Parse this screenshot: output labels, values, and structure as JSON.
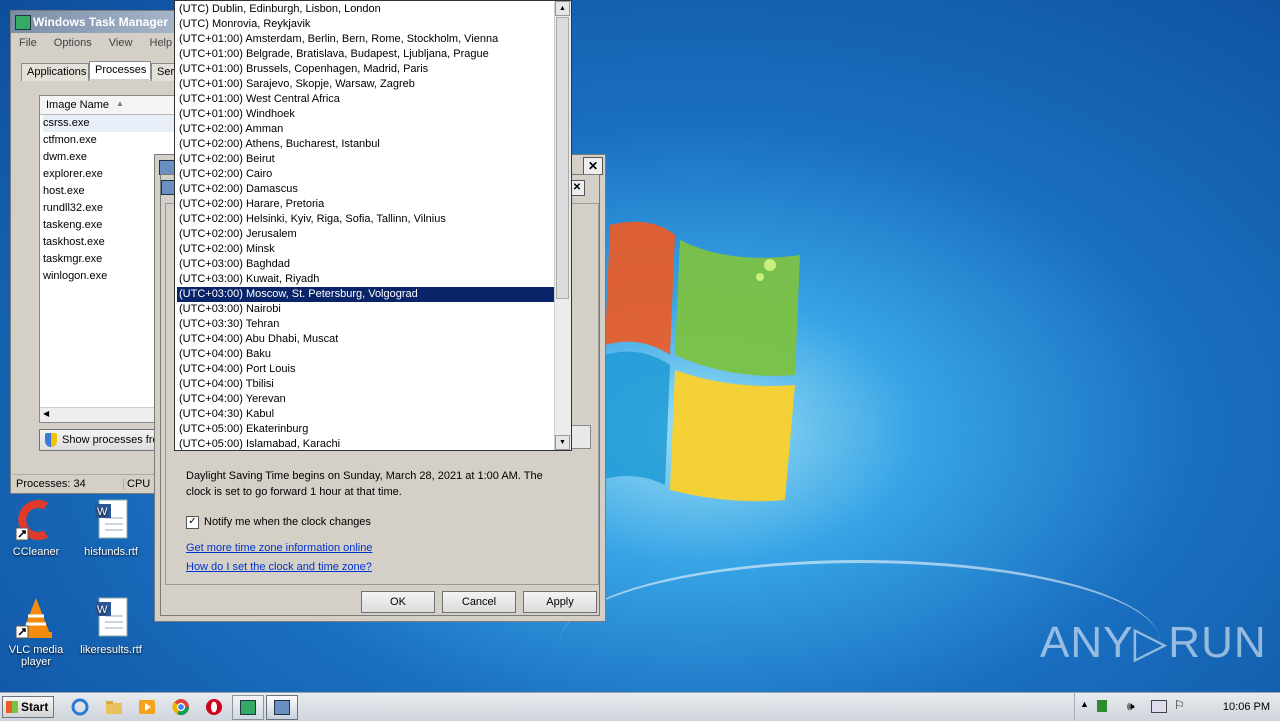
{
  "taskmgr": {
    "title": "Windows Task Manager",
    "menus": [
      "File",
      "Options",
      "View",
      "Help"
    ],
    "tabs": [
      "Applications",
      "Processes",
      "Serv"
    ],
    "column_header": "Image Name",
    "processes": [
      "csrss.exe",
      "ctfmon.exe",
      "dwm.exe",
      "explorer.exe",
      "host.exe",
      "rundll32.exe",
      "taskeng.exe",
      "taskhost.exe",
      "taskmgr.exe",
      "winlogon.exe"
    ],
    "show_processes_label": "Show processes fro",
    "status_processes": "Processes: 34",
    "status_cpu": "CPU Us"
  },
  "timezone_list": {
    "items": [
      "(UTC) Dublin, Edinburgh, Lisbon, London",
      "(UTC) Monrovia, Reykjavik",
      "(UTC+01:00) Amsterdam, Berlin, Bern, Rome, Stockholm, Vienna",
      "(UTC+01:00) Belgrade, Bratislava, Budapest, Ljubljana, Prague",
      "(UTC+01:00) Brussels, Copenhagen, Madrid, Paris",
      "(UTC+01:00) Sarajevo, Skopje, Warsaw, Zagreb",
      "(UTC+01:00) West Central Africa",
      "(UTC+01:00) Windhoek",
      "(UTC+02:00) Amman",
      "(UTC+02:00) Athens, Bucharest, Istanbul",
      "(UTC+02:00) Beirut",
      "(UTC+02:00) Cairo",
      "(UTC+02:00) Damascus",
      "(UTC+02:00) Harare, Pretoria",
      "(UTC+02:00) Helsinki, Kyiv, Riga, Sofia, Tallinn, Vilnius",
      "(UTC+02:00) Jerusalem",
      "(UTC+02:00) Minsk",
      "(UTC+03:00) Baghdad",
      "(UTC+03:00) Kuwait, Riyadh",
      "(UTC+03:00) Moscow, St. Petersburg, Volgograd",
      "(UTC+03:00) Nairobi",
      "(UTC+03:30) Tehran",
      "(UTC+04:00) Abu Dhabi, Muscat",
      "(UTC+04:00) Baku",
      "(UTC+04:00) Port Louis",
      "(UTC+04:00) Tbilisi",
      "(UTC+04:00) Yerevan",
      "(UTC+04:30) Kabul",
      "(UTC+05:00) Ekaterinburg",
      "(UTC+05:00) Islamabad, Karachi"
    ],
    "selected_index": 19
  },
  "tz_dialog": {
    "dst_text_line1": "Daylight Saving Time begins on Sunday, March 28, 2021 at 1:00 AM. The",
    "dst_text_line2": "clock is set to go forward 1 hour at that time.",
    "notify_label": "Notify me when the clock changes",
    "notify_checked": true,
    "link_more_info": "Get more time zone information online",
    "link_how_set": "How do I set the clock and time zone?",
    "ok_label": "OK",
    "cancel_label": "Cancel",
    "apply_label": "Apply",
    "close_glyph": "✕"
  },
  "desktop_icons": [
    {
      "label": "CCleaner",
      "icon": "ccleaner-icon"
    },
    {
      "label": "hisfunds.rtf",
      "icon": "word-document-icon"
    },
    {
      "label": "VLC media player",
      "icon": "vlc-icon"
    },
    {
      "label": "likeresults.rtf",
      "icon": "word-document-icon"
    }
  ],
  "watermark": "ANY▷RUN",
  "taskbar": {
    "start_label": "Start",
    "clock": "10:06 PM"
  },
  "colors": {
    "selection": "#0a246a",
    "link": "#0033cc",
    "dialog_bg": "#d4d0c8"
  }
}
